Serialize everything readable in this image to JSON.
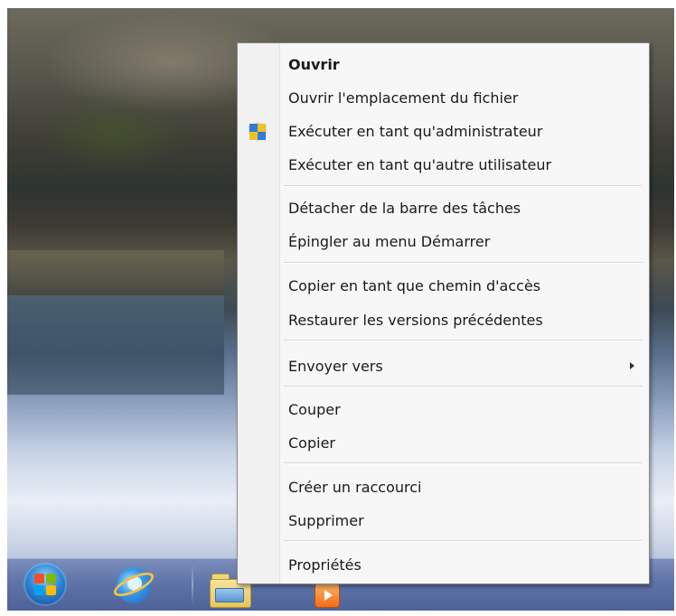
{
  "context_menu": {
    "items": [
      {
        "label": "Ouvrir",
        "bold": true
      },
      {
        "label": "Ouvrir l'emplacement du fichier"
      },
      {
        "label": "Exécuter en tant qu'administrateur",
        "icon": "uac-shield-icon"
      },
      {
        "label": "Exécuter en tant qu'autre utilisateur"
      },
      {
        "label": "Détacher de la barre des tâches"
      },
      {
        "label": "Épingler au menu Démarrer"
      },
      {
        "label": "Copier en tant que chemin d'accès"
      },
      {
        "label": "Restaurer les versions précédentes"
      },
      {
        "label": "Envoyer vers",
        "submenu": true
      },
      {
        "label": "Couper"
      },
      {
        "label": "Copier"
      },
      {
        "label": "Créer un raccourci"
      },
      {
        "label": "Supprimer"
      },
      {
        "label": "Propriétés"
      }
    ]
  },
  "taskbar": {
    "icons": [
      "start-orb",
      "internet-explorer-icon",
      "windows-explorer-icon",
      "media-player-icon"
    ]
  },
  "colors": {
    "menu_background": "#f7f7f7",
    "menu_border": "#8a8a8a",
    "taskbar": "#5f74a8"
  }
}
